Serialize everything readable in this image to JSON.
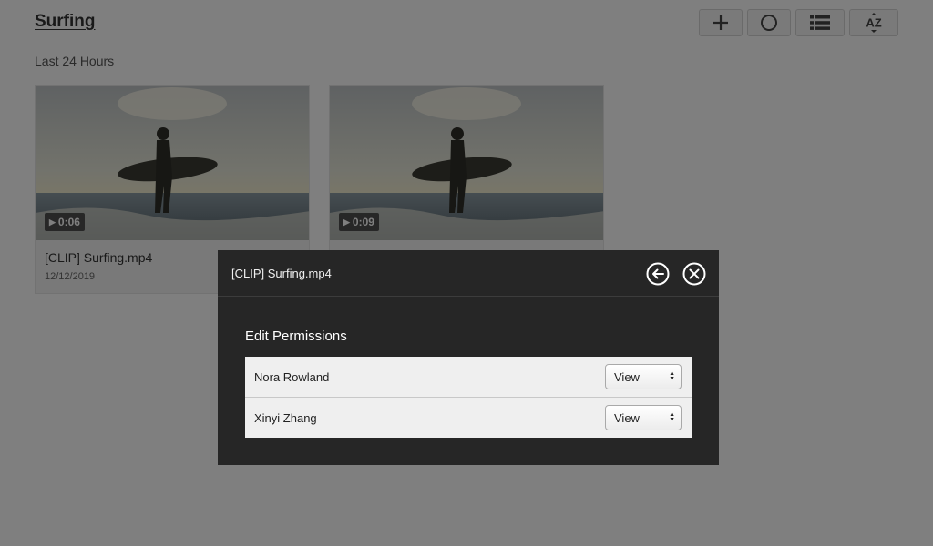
{
  "page": {
    "title": "Surfing",
    "section_label": "Last 24 Hours"
  },
  "toolbar": {
    "icons": [
      "plus-icon",
      "circle-icon",
      "list-icon",
      "sort-az-icon"
    ],
    "sort_label": "AZ"
  },
  "cards": [
    {
      "duration": "0:06",
      "title": "[CLIP] Surfing.mp4",
      "date": "12/12/2019"
    },
    {
      "duration": "0:09",
      "title": "",
      "date": ""
    }
  ],
  "modal": {
    "title": "[CLIP] Surfing.mp4",
    "section_heading": "Edit Permissions",
    "permissions": [
      {
        "name": "Nora Rowland",
        "level": "View"
      },
      {
        "name": "Xinyi Zhang",
        "level": "View"
      }
    ]
  },
  "colors": {
    "modal_background": "#262626",
    "overlay": "rgba(0,0,0,0.5)",
    "permission_row": "#efefef"
  }
}
